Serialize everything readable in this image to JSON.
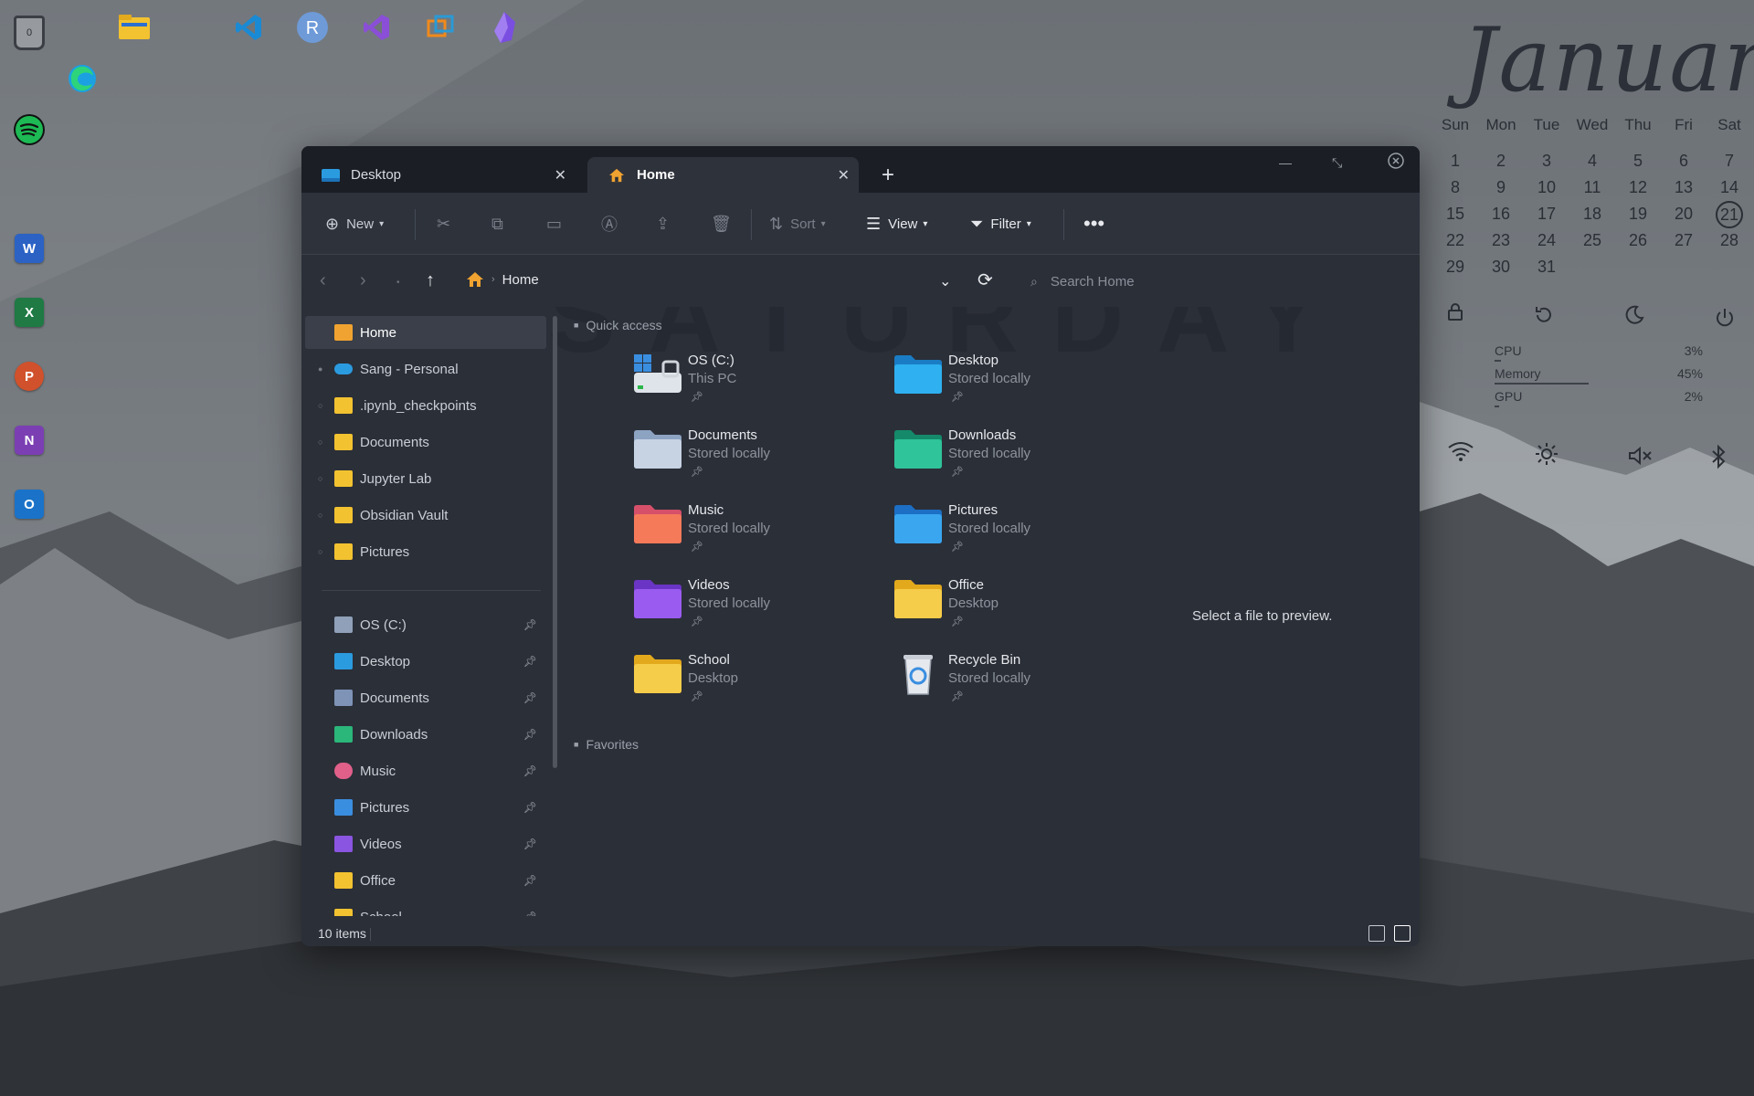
{
  "calendar": {
    "month": "January",
    "weekdays": [
      "Sun",
      "Mon",
      "Tue",
      "Wed",
      "Thu",
      "Fri",
      "Sat"
    ],
    "weeks": [
      [
        "1",
        "2",
        "3",
        "4",
        "5",
        "6",
        "7"
      ],
      [
        "8",
        "9",
        "10",
        "11",
        "12",
        "13",
        "14"
      ],
      [
        "15",
        "16",
        "17",
        "18",
        "19",
        "20",
        "21"
      ],
      [
        "22",
        "23",
        "24",
        "25",
        "26",
        "27",
        "28"
      ],
      [
        "29",
        "30",
        "31",
        "",
        "",
        "",
        ""
      ]
    ],
    "today": "21"
  },
  "system_stats": [
    {
      "label": "CPU",
      "value": "3%",
      "level": 0.03
    },
    {
      "label": "Memory",
      "value": "45%",
      "level": 0.45
    },
    {
      "label": "GPU",
      "value": "2%",
      "level": 0.02
    }
  ],
  "desktop": {
    "recycle_count": "0"
  },
  "window": {
    "tabs": [
      {
        "label": "Desktop"
      },
      {
        "label": "Home"
      }
    ],
    "toolbar": {
      "new_label": "New",
      "sort_label": "Sort",
      "view_label": "View",
      "filter_label": "Filter"
    },
    "address": {
      "crumb": "Home",
      "search_placeholder": "Search Home"
    },
    "watermark_text": "SATURDAY",
    "sidebar": {
      "items": [
        {
          "label": "Home"
        },
        {
          "label": "Sang - Personal"
        },
        {
          "label": ".ipynb_checkpoints"
        },
        {
          "label": "Documents"
        },
        {
          "label": "Jupyter Lab"
        },
        {
          "label": "Obsidian Vault"
        },
        {
          "label": "Pictures"
        }
      ],
      "pinned": [
        {
          "label": "OS (C:)"
        },
        {
          "label": "Desktop"
        },
        {
          "label": "Documents"
        },
        {
          "label": "Downloads"
        },
        {
          "label": "Music"
        },
        {
          "label": "Pictures"
        },
        {
          "label": "Videos"
        },
        {
          "label": "Office"
        },
        {
          "label": "School"
        }
      ]
    },
    "quick_access_title": "Quick access",
    "favorites_title": "Favorites",
    "quick_access": [
      {
        "name": "OS (C:)",
        "sub": "This PC"
      },
      {
        "name": "Desktop",
        "sub": "Stored locally"
      },
      {
        "name": "Documents",
        "sub": "Stored locally"
      },
      {
        "name": "Downloads",
        "sub": "Stored locally"
      },
      {
        "name": "Music",
        "sub": "Stored locally"
      },
      {
        "name": "Pictures",
        "sub": "Stored locally"
      },
      {
        "name": "Videos",
        "sub": "Stored locally"
      },
      {
        "name": "Office",
        "sub": "Desktop"
      },
      {
        "name": "School",
        "sub": "Desktop"
      },
      {
        "name": "Recycle Bin",
        "sub": "Stored locally"
      }
    ],
    "preview_text": "Select a file to preview.",
    "status": {
      "item_count": "10 items"
    }
  }
}
